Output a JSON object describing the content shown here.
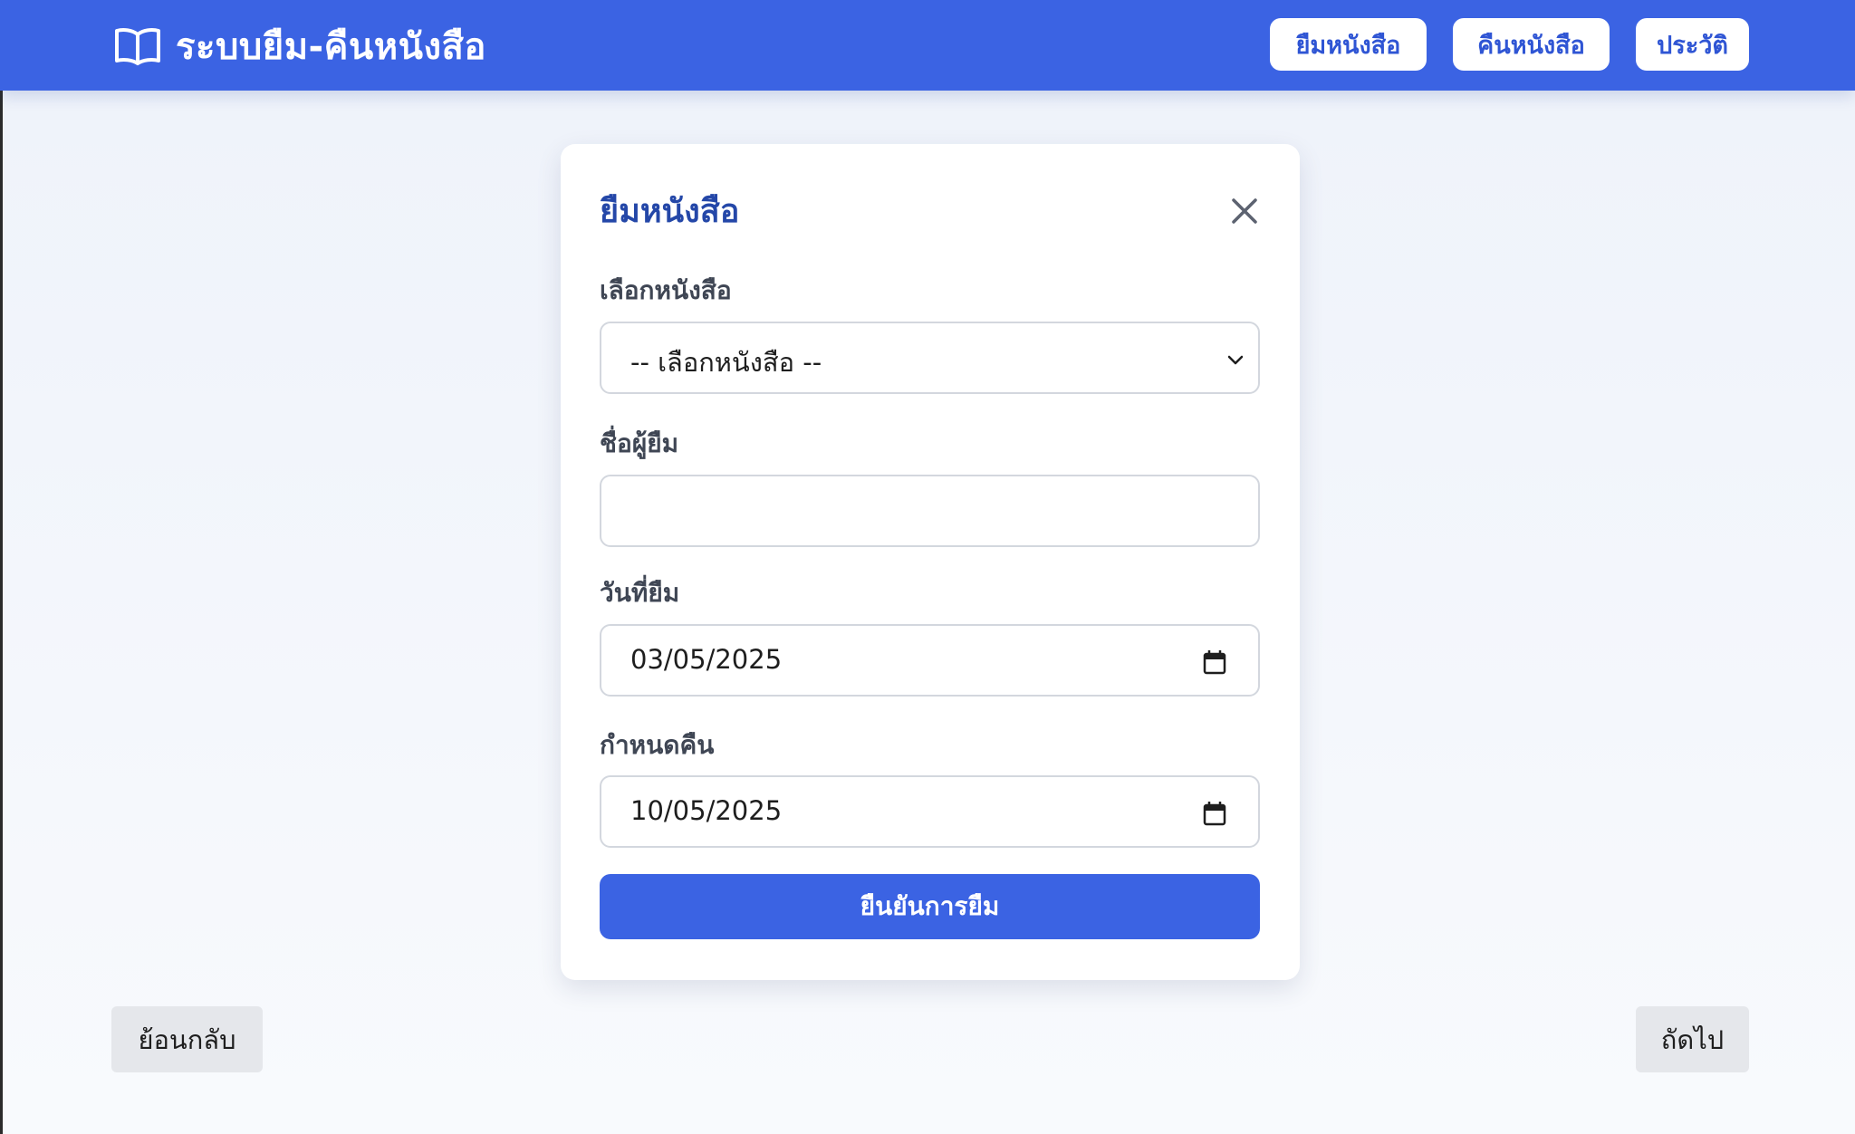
{
  "app": {
    "title": "ระบบยืม-คืนหนังสือ",
    "logo_icon": "open-book-icon"
  },
  "nav": {
    "items": [
      {
        "label": "ยืมหนังสือ"
      },
      {
        "label": "คืนหนังสือ"
      },
      {
        "label": "ประวัติ"
      }
    ]
  },
  "modal": {
    "title": "ยืมหนังสือ",
    "close_icon": "close-icon",
    "book_select": {
      "label": "เลือกหนังสือ",
      "selected": "-- เลือกหนังสือ --"
    },
    "borrower_name": {
      "label": "ชื่อผู้ยืม",
      "value": ""
    },
    "borrow_date": {
      "label": "วันที่ยืม",
      "value": "03/05/2025"
    },
    "due_date": {
      "label": "กำหนดคืน",
      "value": "10/05/2025"
    },
    "submit_label": "ยืนยันการยืม"
  },
  "footer": {
    "back_label": "ย้อนกลับ",
    "next_label": "ถัดไป"
  },
  "colors": {
    "primary": "#3b63e3",
    "title_blue": "#2447a8",
    "secondary_button": "#e5e7eb"
  }
}
